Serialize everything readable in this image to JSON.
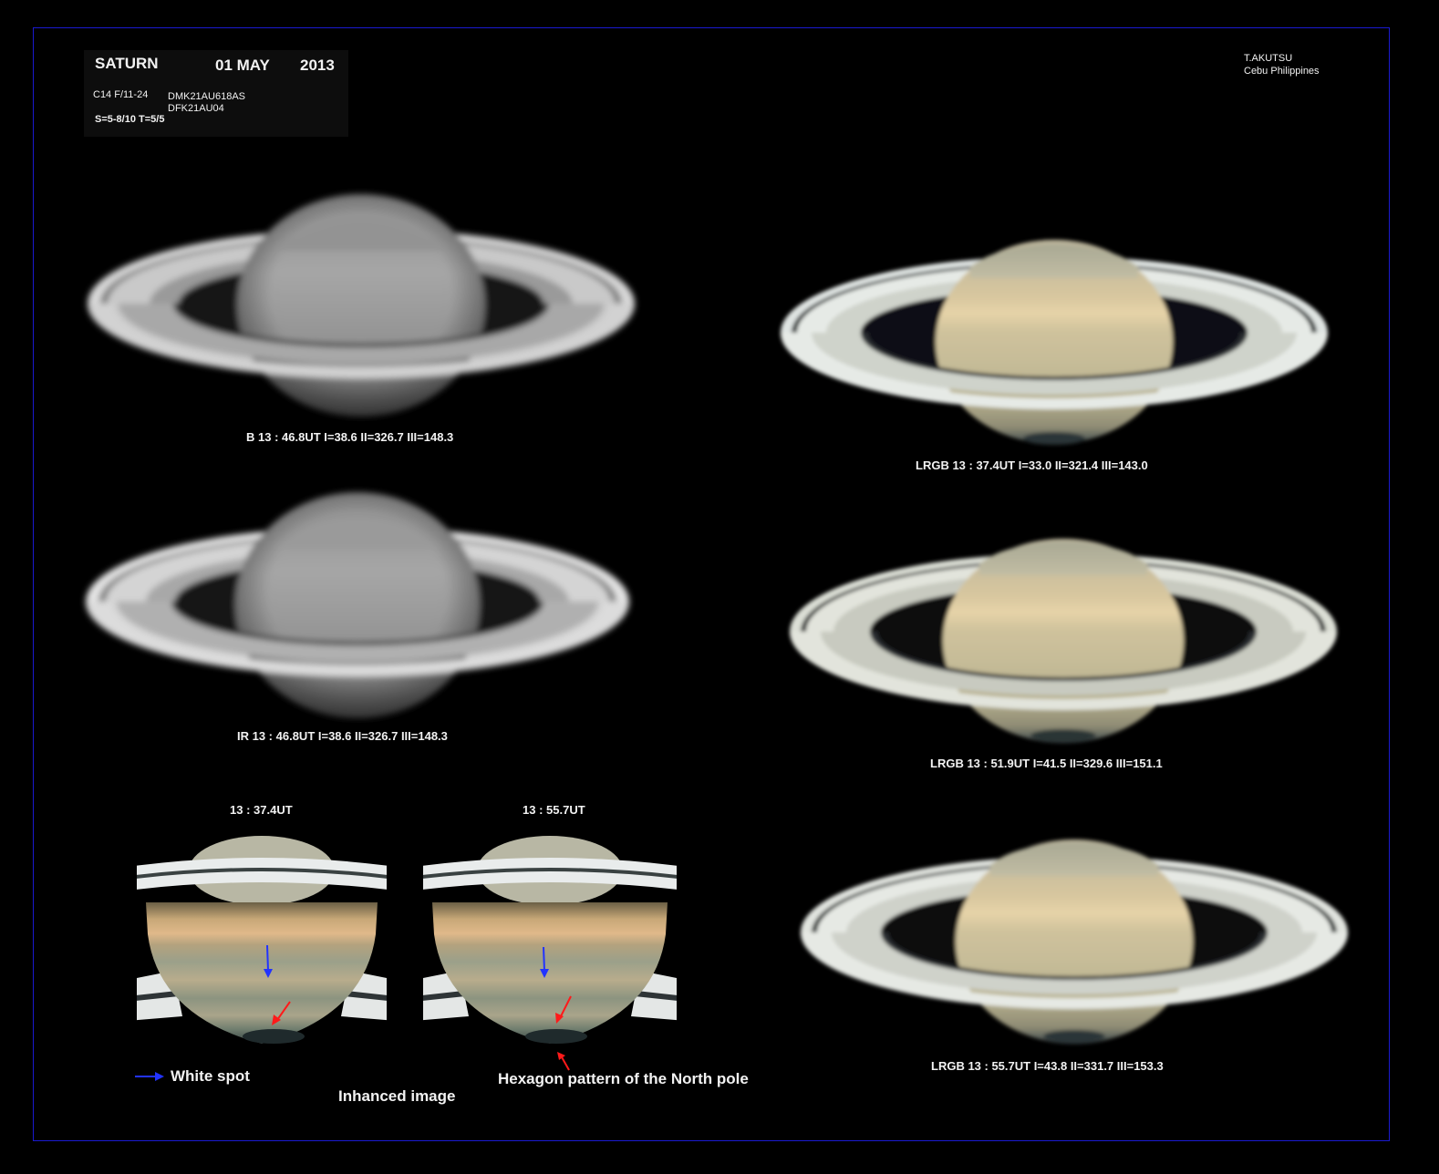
{
  "header": {
    "object": "SATURN",
    "date_day_month": "01  MAY",
    "year": "2013",
    "observer": "T.AKUTSU",
    "location": "Cebu  Philippines",
    "telescope": "C14  F/11-24",
    "camera_1": "DMK21AU618AS",
    "camera_2": "DFK21AU04",
    "seeing_transparency": "S=5-8/10    T=5/5"
  },
  "captions": {
    "b_filter": "B   13 :  46.8UT   I=38.6   II=326.7   III=148.3",
    "ir_filter": "IR   13 : 46.8UT   I=38.6   II=326.7   III=148.3",
    "lrgb_1": "LRGB   13 : 37.4UT   I=33.0   II=321.4   III=143.0",
    "lrgb_2": "LRGB   13 : 51.9UT   I=41.5   II=329.6   III=151.1",
    "lrgb_3": "LRGB   13 : 55.7UT   I=43.8   II=331.7   III=153.3"
  },
  "enhanced": {
    "time_left": "13 : 37.4UT",
    "time_right": "13 : 55.7UT",
    "legend_white_spot": "White spot",
    "hexagon_note": "Hexagon pattern of  the North pole",
    "label": "Inhanced  image"
  },
  "colors": {
    "frame": "#1a1ad0",
    "white_spot_arrow": "#2233ff",
    "hexagon_arrow": "#ff1a1a"
  }
}
